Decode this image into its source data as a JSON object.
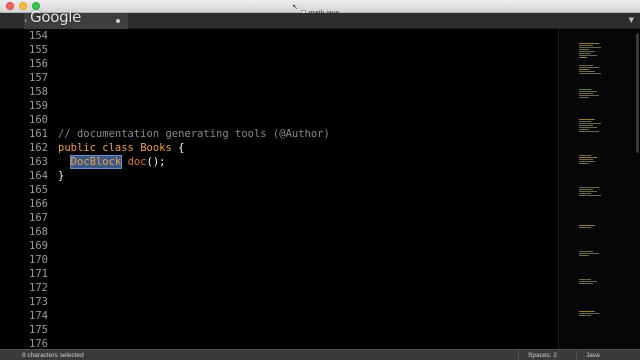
{
  "window": {
    "title": "math.java"
  },
  "watermark": {
    "text": "Google"
  },
  "editor": {
    "lines": [
      {
        "num": "154",
        "tokens": []
      },
      {
        "num": "155",
        "tokens": []
      },
      {
        "num": "156",
        "tokens": []
      },
      {
        "num": "157",
        "tokens": []
      },
      {
        "num": "158",
        "tokens": []
      },
      {
        "num": "159",
        "tokens": []
      },
      {
        "num": "160",
        "tokens": []
      },
      {
        "num": "161",
        "tokens": [
          {
            "t": "// documentation generating tools (@Author)",
            "k": "comment"
          }
        ]
      },
      {
        "num": "162",
        "tokens": [
          {
            "t": "public class ",
            "k": "keyword"
          },
          {
            "t": "Books",
            "k": "class"
          },
          {
            "t": " {",
            "k": "plain"
          }
        ]
      },
      {
        "num": "163",
        "tokens": [
          {
            "t": "  ",
            "k": "plain"
          },
          {
            "t": "DocBlock",
            "k": "type"
          },
          {
            "t": " ",
            "k": "plain"
          },
          {
            "t": "doc",
            "k": "func"
          },
          {
            "t": "();",
            "k": "plain"
          }
        ]
      },
      {
        "num": "164",
        "tokens": [
          {
            "t": "}",
            "k": "plain"
          }
        ]
      },
      {
        "num": "165",
        "tokens": []
      },
      {
        "num": "166",
        "tokens": []
      },
      {
        "num": "167",
        "tokens": []
      },
      {
        "num": "168",
        "tokens": []
      },
      {
        "num": "169",
        "tokens": []
      },
      {
        "num": "170",
        "tokens": []
      },
      {
        "num": "171",
        "tokens": []
      },
      {
        "num": "172",
        "tokens": []
      },
      {
        "num": "173",
        "tokens": []
      },
      {
        "num": "174",
        "tokens": []
      },
      {
        "num": "175",
        "tokens": []
      },
      {
        "num": "176",
        "tokens": []
      }
    ]
  },
  "statusbar": {
    "selection": "8 characters selected",
    "spaces": "Spaces: 2",
    "language": "Java"
  },
  "colors": {
    "background": "#000000",
    "comment": "#8a8a8a",
    "keyword": "#f0a040",
    "function": "#e07040",
    "selection": "#3a5a8c",
    "line_number": "#9a9a9a"
  },
  "icons": {
    "close": "close-icon",
    "minimize": "minimize-icon",
    "maximize": "maximize-icon",
    "tab_left": "chevron-left-icon",
    "tab_dirty": "dot-icon",
    "tab_dropdown": "chevron-down-icon",
    "file": "file-icon"
  }
}
